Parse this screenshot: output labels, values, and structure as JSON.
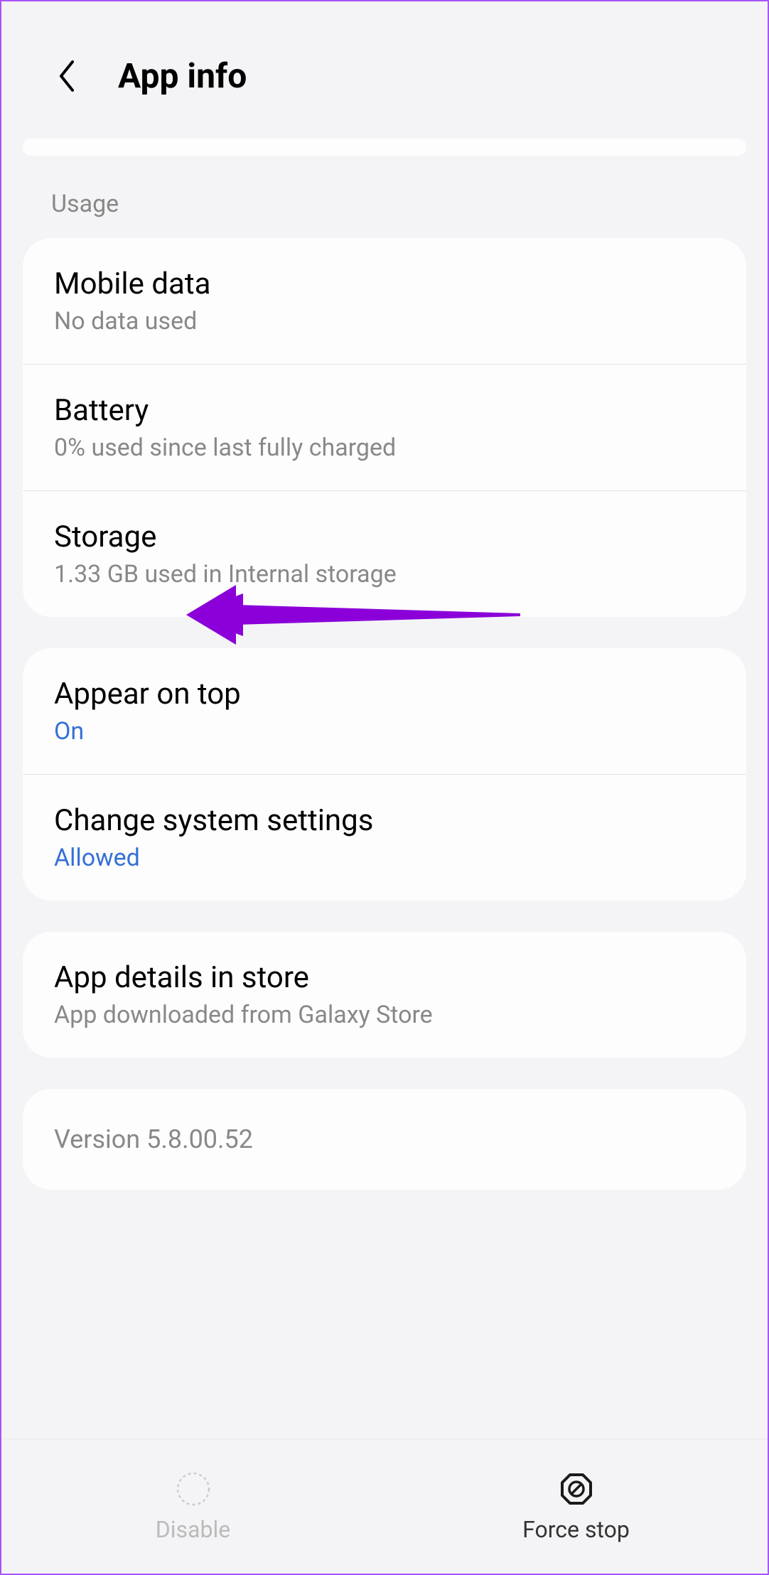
{
  "header": {
    "title": "App info"
  },
  "usage": {
    "section_label": "Usage",
    "mobile_data": {
      "title": "Mobile data",
      "subtitle": "No data used"
    },
    "battery": {
      "title": "Battery",
      "subtitle": "0% used since last fully charged"
    },
    "storage": {
      "title": "Storage",
      "subtitle": "1.33 GB used in Internal storage"
    }
  },
  "advanced": {
    "appear_on_top": {
      "title": "Appear on top",
      "subtitle": "On"
    },
    "change_system_settings": {
      "title": "Change system settings",
      "subtitle": "Allowed"
    }
  },
  "store": {
    "app_details": {
      "title": "App details in store",
      "subtitle": "App downloaded from Galaxy Store"
    }
  },
  "version": {
    "text": "Version 5.8.00.52"
  },
  "bottom_bar": {
    "disable": "Disable",
    "force_stop": "Force stop"
  }
}
